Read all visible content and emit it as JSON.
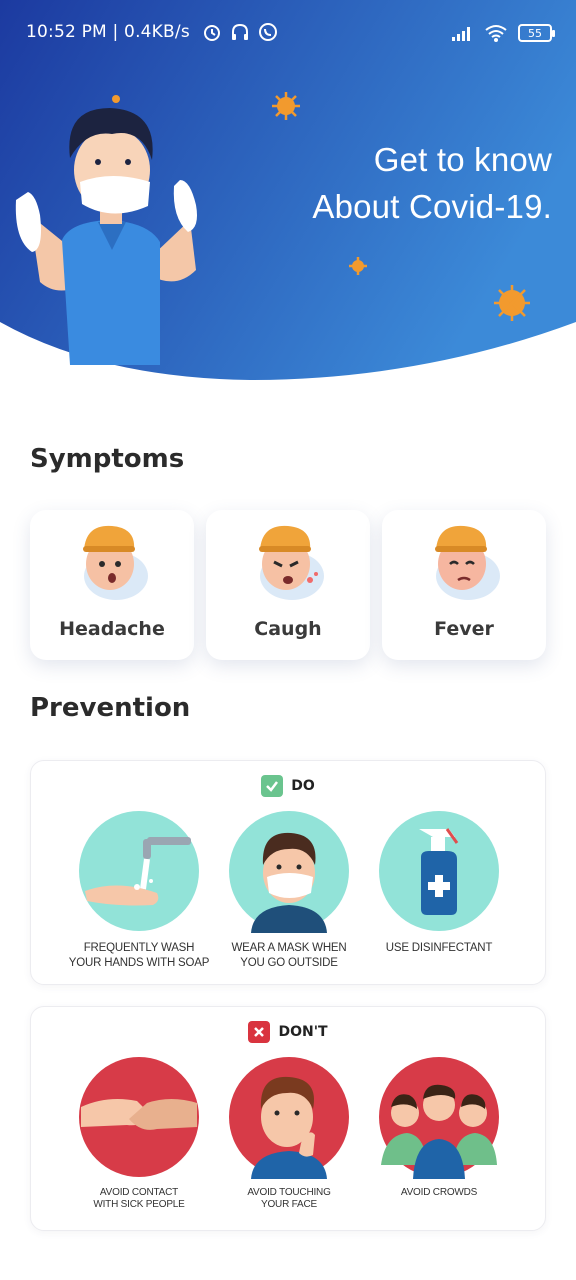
{
  "status_bar": {
    "time_speed": "10:52 PM | 0.4KB/s",
    "battery": "55"
  },
  "hero": {
    "title_line1": "Get to know",
    "title_line2": "About Covid-19."
  },
  "symptoms": {
    "title": "Symptoms",
    "items": [
      {
        "label": "Headache"
      },
      {
        "label": "Caugh"
      },
      {
        "label": "Fever"
      }
    ]
  },
  "prevention": {
    "title": "Prevention",
    "do": {
      "label": "DO",
      "items": [
        {
          "line1": "FREQUENTLY WASH",
          "line2": "YOUR HANDS WITH SOAP"
        },
        {
          "line1": "WEAR A MASK WHEN",
          "line2": "YOU GO OUTSIDE"
        },
        {
          "line1": "USE DISINFECTANT",
          "line2": ""
        }
      ]
    },
    "dont": {
      "label": "DON'T",
      "items": [
        {
          "line1": "AVOID CONTACT",
          "line2": "WITH SICK PEOPLE"
        },
        {
          "line1": "AVOID TOUCHING",
          "line2": "YOUR FACE"
        },
        {
          "line1": "AVOID CROWDS",
          "line2": ""
        }
      ]
    }
  },
  "colors": {
    "hero_gradient_start": "#1d3fa5",
    "hero_gradient_end": "#3a86d6",
    "do_green": "#6ac48e",
    "dont_red": "#d9343f",
    "circle_teal": "#92e3d8",
    "circle_red": "#d73b48"
  }
}
